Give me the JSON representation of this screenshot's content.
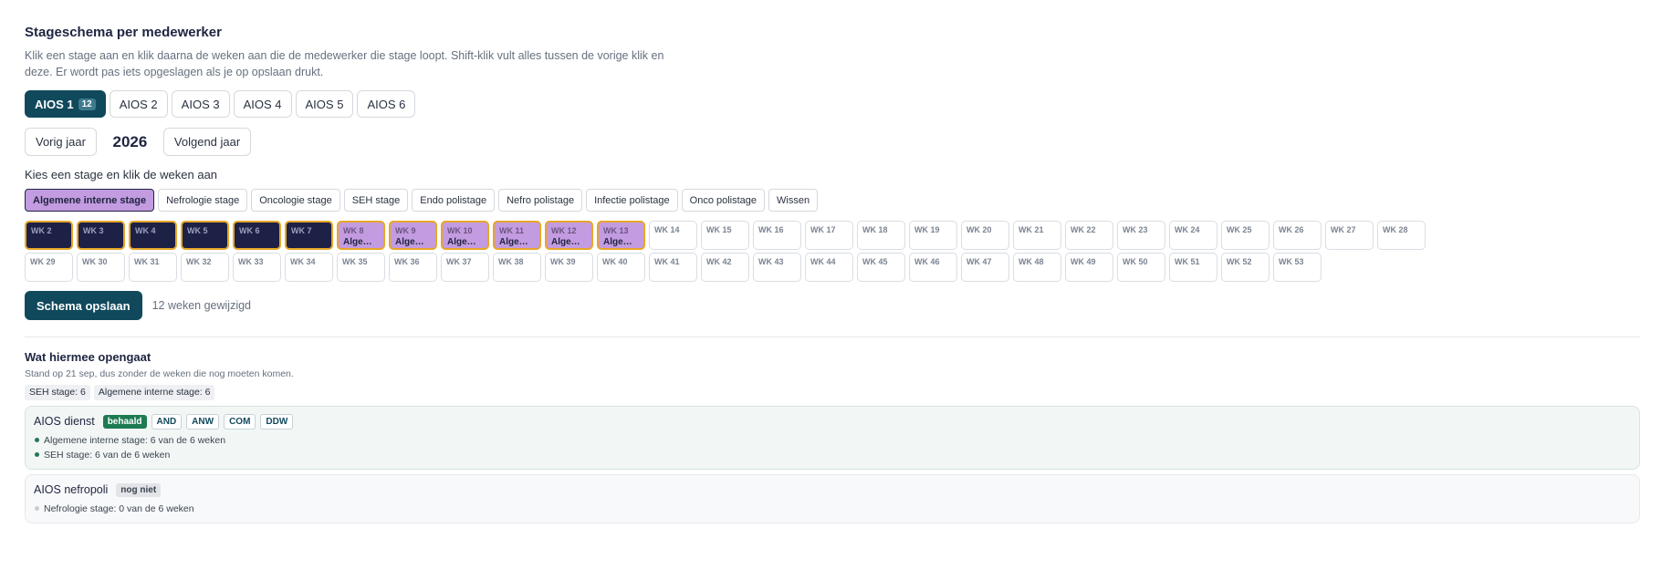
{
  "header": {
    "title": "Stageschema per medewerker",
    "description": "Klik een stage aan en klik daarna de weken aan die de medewerker die stage loopt. Shift-klik vult alles tussen de vorige klik en deze. Er wordt pas iets opgeslagen als je op opslaan drukt."
  },
  "aios_tabs": [
    {
      "label": "AIOS 1",
      "count": "12"
    },
    {
      "label": "AIOS 2"
    },
    {
      "label": "AIOS 3"
    },
    {
      "label": "AIOS 4"
    },
    {
      "label": "AIOS 5"
    },
    {
      "label": "AIOS 6"
    }
  ],
  "year_nav": {
    "prev": "Vorig jaar",
    "year": "2026",
    "next": "Volgend jaar"
  },
  "stage_picker": {
    "label": "Kies een stage en klik de weken aan",
    "options": [
      "Algemene interne stage",
      "Nefrologie stage",
      "Oncologie stage",
      "SEH stage",
      "Endo polistage",
      "Nefro polistage",
      "Infectie polistage",
      "Onco polistage",
      "Wissen"
    ],
    "selected": "Algemene interne stage"
  },
  "weeks": [
    {
      "label": "WK 2",
      "stage": "",
      "style": "dark"
    },
    {
      "label": "WK 3",
      "stage": "",
      "style": "dark"
    },
    {
      "label": "WK 4",
      "stage": "",
      "style": "dark"
    },
    {
      "label": "WK 5",
      "stage": "",
      "style": "dark"
    },
    {
      "label": "WK 6",
      "stage": "",
      "style": "dark"
    },
    {
      "label": "WK 7",
      "stage": "",
      "style": "dark"
    },
    {
      "label": "WK 8",
      "stage": "Algemene interne stage",
      "style": "purple"
    },
    {
      "label": "WK 9",
      "stage": "Algemene interne stage",
      "style": "purple"
    },
    {
      "label": "WK 10",
      "stage": "Algemene interne stage",
      "style": "purple"
    },
    {
      "label": "WK 11",
      "stage": "Algemene interne stage",
      "style": "purple"
    },
    {
      "label": "WK 12",
      "stage": "Algemene interne stage",
      "style": "purple"
    },
    {
      "label": "WK 13",
      "stage": "Algemene interne stage",
      "style": "purple"
    },
    {
      "label": "WK 14"
    },
    {
      "label": "WK 15"
    },
    {
      "label": "WK 16"
    },
    {
      "label": "WK 17"
    },
    {
      "label": "WK 18"
    },
    {
      "label": "WK 19"
    },
    {
      "label": "WK 20"
    },
    {
      "label": "WK 21"
    },
    {
      "label": "WK 22"
    },
    {
      "label": "WK 23"
    },
    {
      "label": "WK 24"
    },
    {
      "label": "WK 25"
    },
    {
      "label": "WK 26"
    },
    {
      "label": "WK 27"
    },
    {
      "label": "WK 28"
    },
    {
      "label": "WK 29"
    },
    {
      "label": "WK 30"
    },
    {
      "label": "WK 31"
    },
    {
      "label": "WK 32"
    },
    {
      "label": "WK 33"
    },
    {
      "label": "WK 34"
    },
    {
      "label": "WK 35"
    },
    {
      "label": "WK 36"
    },
    {
      "label": "WK 37"
    },
    {
      "label": "WK 38"
    },
    {
      "label": "WK 39"
    },
    {
      "label": "WK 40"
    },
    {
      "label": "WK 41"
    },
    {
      "label": "WK 42"
    },
    {
      "label": "WK 43"
    },
    {
      "label": "WK 44"
    },
    {
      "label": "WK 45"
    },
    {
      "label": "WK 46"
    },
    {
      "label": "WK 47"
    },
    {
      "label": "WK 48"
    },
    {
      "label": "WK 49"
    },
    {
      "label": "WK 50"
    },
    {
      "label": "WK 51"
    },
    {
      "label": "WK 52"
    },
    {
      "label": "WK 53"
    }
  ],
  "save": {
    "label": "Schema opslaan",
    "status": "12 weken gewijzigd"
  },
  "results": {
    "title": "Wat hiermee opengaat",
    "note": "Stand op 21 sep, dus zonder de weken die nog moeten komen.",
    "totals": [
      "SEH stage: 6",
      "Algemene interne stage: 6"
    ],
    "cards": [
      {
        "title": "AIOS dienst",
        "status": "behaald",
        "status_type": "ok",
        "tags": [
          "AND",
          "ANW",
          "COM",
          "DDW"
        ],
        "requirements": [
          {
            "text": "Algemene interne stage: 6 van de 6 weken",
            "met": true
          },
          {
            "text": "SEH stage: 6 van de 6 weken",
            "met": true
          }
        ]
      },
      {
        "title": "AIOS nefropoli",
        "status": "nog niet",
        "status_type": "no",
        "tags": [],
        "requirements": [
          {
            "text": "Nefrologie stage: 0 van de 6 weken",
            "met": false
          }
        ]
      }
    ]
  },
  "colors": {
    "primary": "#10495c",
    "scheduled_dark": "#1e2146",
    "stage_purple": "#c39be0",
    "highlight_border": "#e8a628",
    "success": "#1d7a52"
  }
}
